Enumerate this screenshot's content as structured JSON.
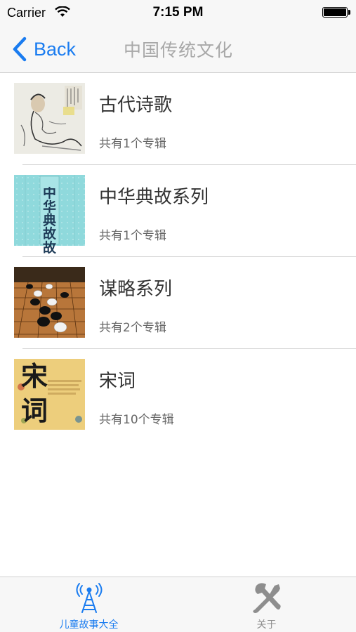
{
  "status_bar": {
    "carrier": "Carrier",
    "time": "7:15 PM",
    "wifi_icon": "wifi-icon",
    "battery_icon": "battery-icon"
  },
  "nav": {
    "back_label": "Back",
    "back_icon": "chevron-left-icon",
    "title": "中国传统文化"
  },
  "list": {
    "items": [
      {
        "title": "古代诗歌",
        "subtitle": "共有1个专辑",
        "image": "ancient-poet-painting"
      },
      {
        "title": "中华典故系列",
        "subtitle": "共有1个专辑",
        "image": "book-cover-chinese-allusions"
      },
      {
        "title": "谋略系列",
        "subtitle": "共有2个专辑",
        "image": "go-board-stones"
      },
      {
        "title": "宋词",
        "subtitle": "共有10个专辑",
        "image": "song-ci-calligraphy"
      }
    ]
  },
  "tabbar": {
    "tabs": [
      {
        "label": "儿童故事大全",
        "icon": "radio-tower-icon",
        "active": true
      },
      {
        "label": "关于",
        "icon": "tools-icon",
        "active": false
      }
    ]
  },
  "colors": {
    "accent": "#1a7cf0",
    "inactive": "#8e8e8e",
    "nav_title": "#a8a8a8"
  },
  "thumb_text": {
    "book_cover": "中华典故故事",
    "song_ci": "宋词"
  }
}
